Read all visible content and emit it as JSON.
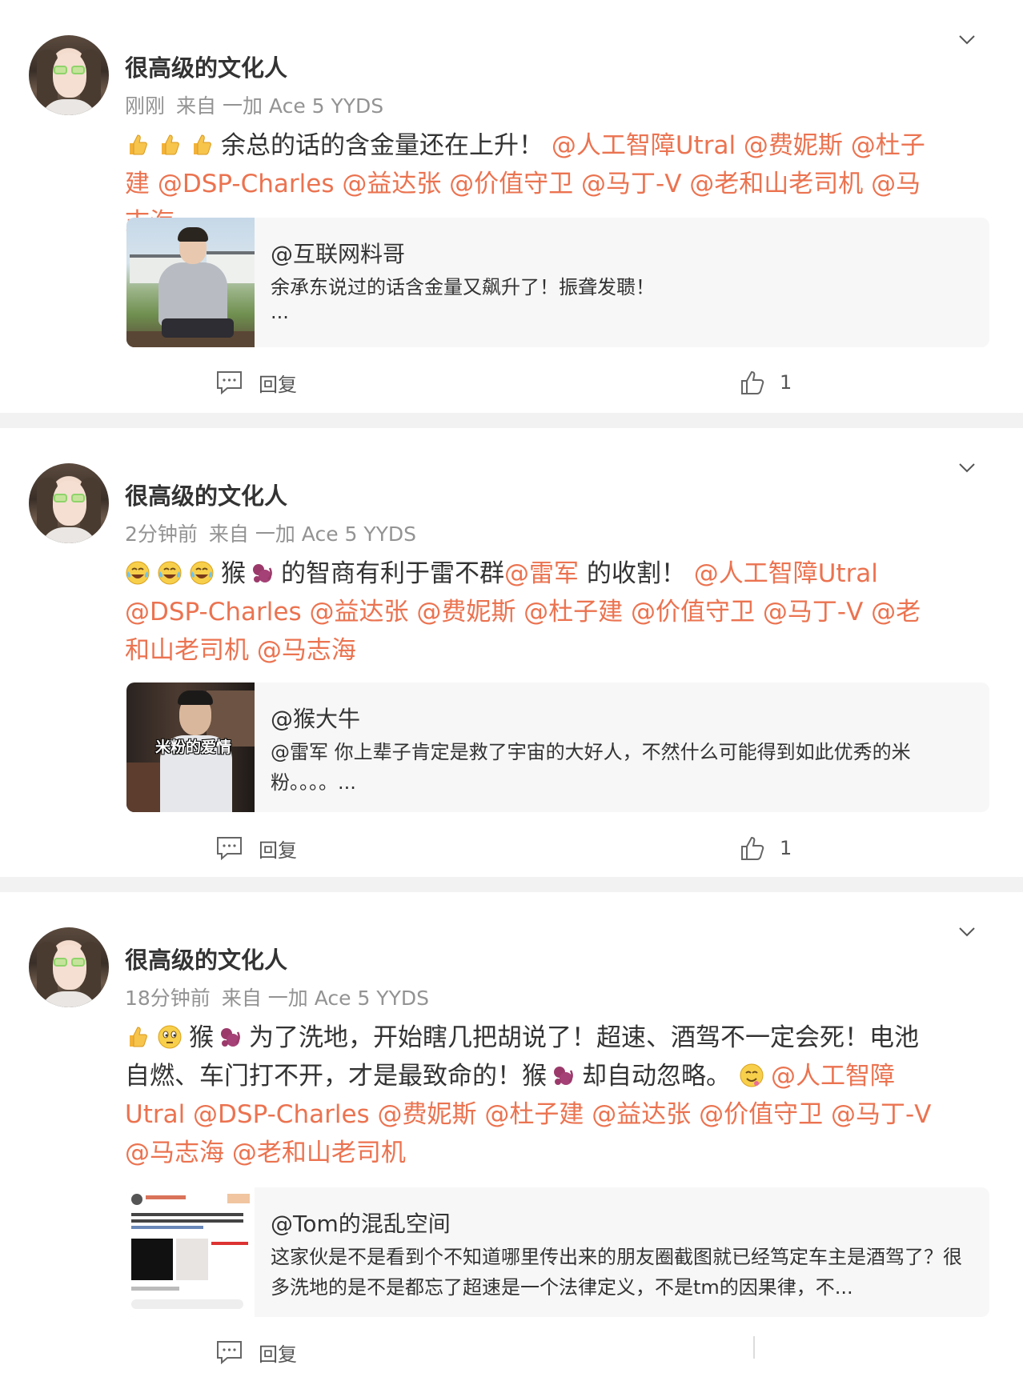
{
  "colors": {
    "mention": "#eb7350",
    "meta": "#939393",
    "background": "#f2f2f2",
    "quote_bg": "#f7f7f7"
  },
  "comments": [
    {
      "username": "很高级的文化人",
      "time": "刚刚",
      "source": "来自 一加 Ace 5 YYDS",
      "emojis": [
        "thumbs-up-icon",
        "thumbs-up-icon",
        "thumbs-up-icon"
      ],
      "text_before": "余总的话的含金量还在上升！",
      "mentions": "@人工智障Utral @费妮斯 @杜子建 @DSP-Charles @益达张 @价值守卫 @马丁-V @老和山老司机 @马志海",
      "quote": {
        "author": "@互联网料哥",
        "text": "余承东说过的话含金量又飙升了！振聋发聩！",
        "ellipsis": "..."
      },
      "reply_label": "回复",
      "like_count": "1"
    },
    {
      "username": "很高级的文化人",
      "time": "2分钟前",
      "source": "来自 一加 Ace 5 YYDS",
      "emojis": [
        "laugh-cry-icon",
        "laugh-cry-icon",
        "laugh-cry-icon"
      ],
      "text_a": "猴",
      "text_b": "的智商有利于雷不群",
      "mention_inline": "@雷军",
      "text_c": " 的收割！ ",
      "mentions": "@人工智障Utral @DSP-Charles @益达张 @费妮斯 @杜子建 @价值守卫 @马丁-V @老和山老司机 @马志海",
      "quote": {
        "author": "@猴大牛",
        "text": "@雷军 你上辈子肯定是救了宇宙的大好人，不然什么可能得到如此优秀的米粉。。。。...",
        "thumb_caption": "米粉的爱情"
      },
      "reply_label": "回复",
      "like_count": "1"
    },
    {
      "username": "很高级的文化人",
      "time": "18分钟前",
      "source": "来自 一加 Ace 5 YYDS",
      "text_a": "猴",
      "text_b": "为了洗地，开始瞎几把胡说了！超速、酒驾不一定会死！电池自燃、车门打不开，才是最致命的！猴",
      "text_c": "却自动忽略。",
      "mentions": "@人工智障Utral @DSP-Charles @费妮斯 @杜子建 @益达张 @价值守卫 @马丁-V @马志海 @老和山老司机",
      "quote": {
        "author": "@Tom的混乱空间",
        "text": "这家伙是不是看到个不知道哪里传出来的朋友圈截图就已经笃定车主是酒驾了？很多洗地的是不是都忘了超速是一个法律定义，不是tm的因果律，不..."
      },
      "reply_label": "回复"
    }
  ]
}
